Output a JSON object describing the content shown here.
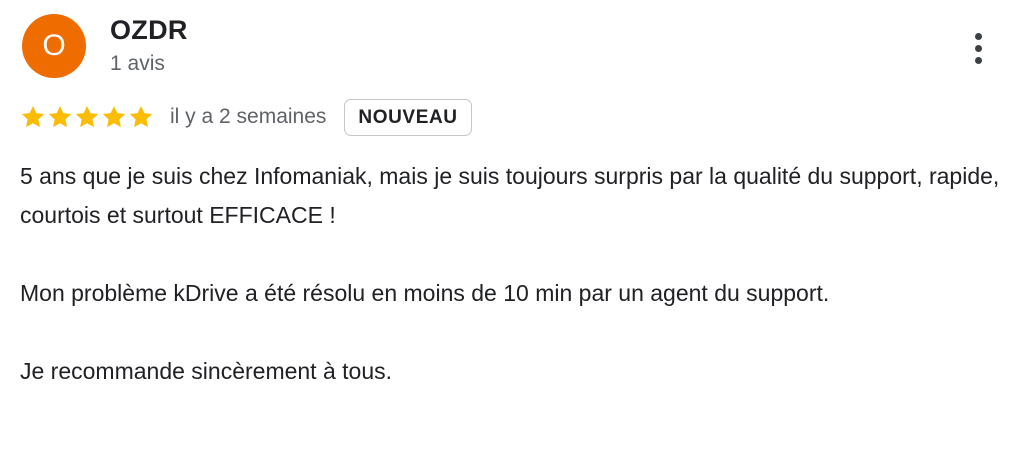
{
  "author": {
    "initial": "O",
    "name": "OZDR",
    "review_count": "1 avis",
    "avatar_color": "#ef6c00"
  },
  "menu": {
    "icon": "more-vert-icon"
  },
  "rating": {
    "stars": 5,
    "max_stars": 5,
    "star_color": "#fbbc04",
    "date": "il y a 2 semaines",
    "badge": "NOUVEAU"
  },
  "review": {
    "paragraphs": [
      "5 ans que je suis chez Infomaniak, mais je suis toujours surpris par la qualité du support, rapide, courtois et surtout EFFICACE !",
      "Mon problème kDrive a été résolu en moins de 10 min par un agent du support.",
      "Je recommande sincèrement à tous."
    ]
  }
}
